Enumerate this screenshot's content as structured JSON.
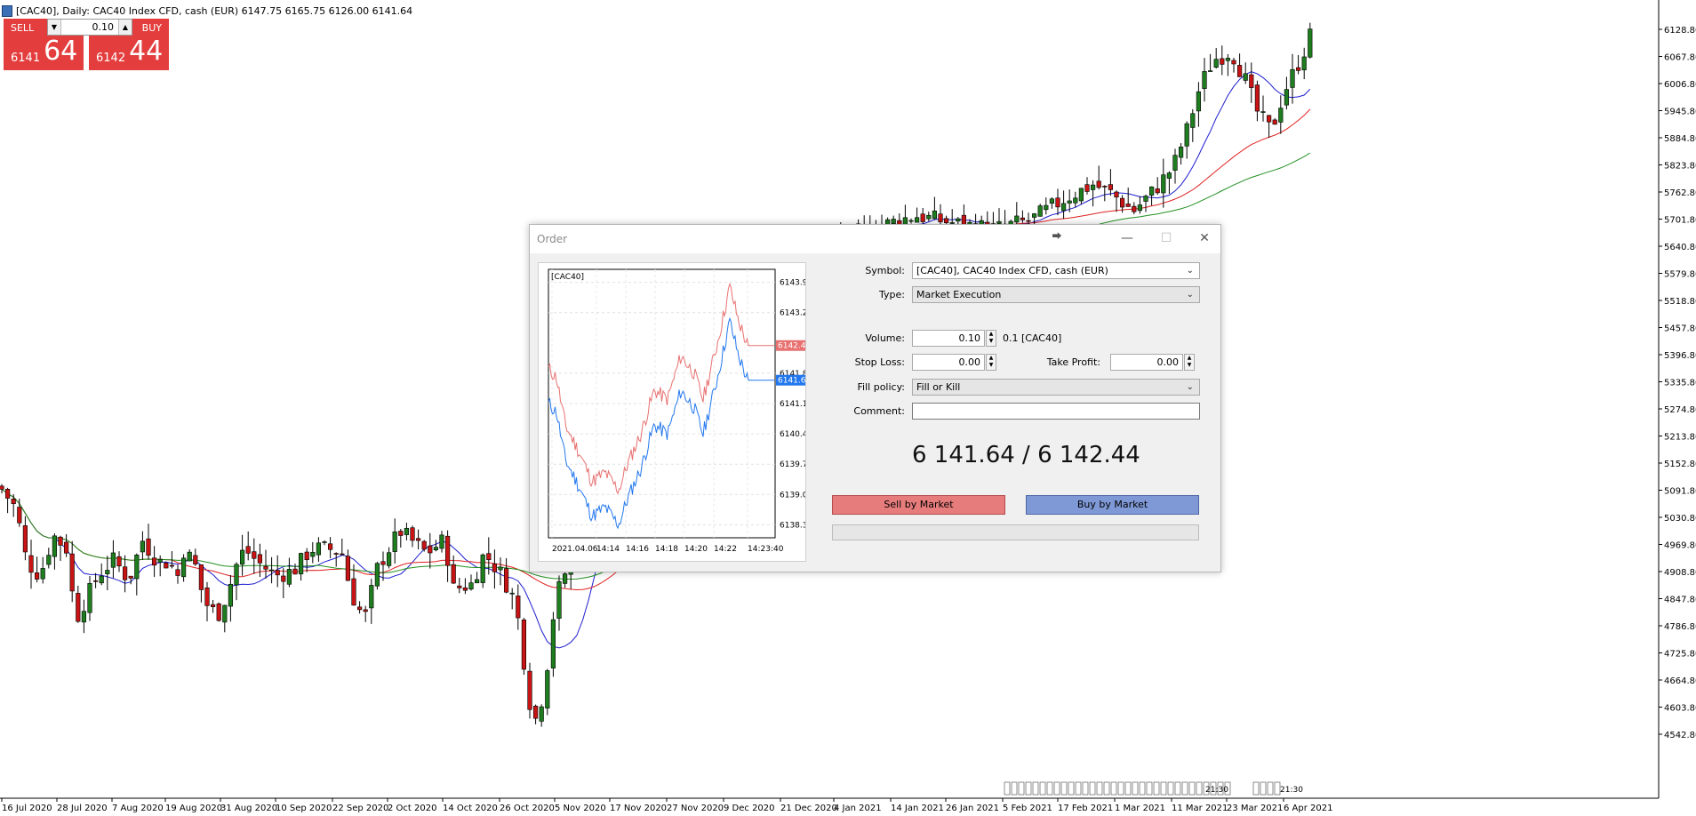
{
  "chart_header": {
    "text": "[CAC40], Daily:  CAC40 Index CFD, cash (EUR)  6147.75 6165.75 6126.00 6141.64"
  },
  "trade_panel": {
    "sell_label": "SELL",
    "buy_label": "BUY",
    "volume": "0.10",
    "sell_price_small": "6141",
    "sell_price_big": "64",
    "buy_price_small": "6142",
    "buy_price_big": "44"
  },
  "chart_data": {
    "type": "candlestick",
    "y_ticks": [
      "6128.80",
      "6067.80",
      "6006.80",
      "5945.80",
      "5884.80",
      "5823.80",
      "5762.80",
      "5701.80",
      "5640.80",
      "5579.80",
      "5518.80",
      "5457.80",
      "5396.80",
      "5335.80",
      "5274.80",
      "5213.80",
      "5152.80",
      "5091.80",
      "5030.80",
      "4969.80",
      "4908.80",
      "4847.80",
      "4786.80",
      "4725.80",
      "4664.80",
      "4603.80",
      "4542.80"
    ],
    "ylim": [
      4520,
      6180
    ],
    "x_labels": [
      "16 Jul 2020",
      "28 Jul 2020",
      "7 Aug 2020",
      "19 Aug 2020",
      "31 Aug 2020",
      "10 Sep 2020",
      "22 Sep 2020",
      "2 Oct 2020",
      "14 Oct 2020",
      "26 Oct 2020",
      "5 Nov 2020",
      "17 Nov 2020",
      "27 Nov 2020",
      "9 Dec 2020",
      "21 Dec 2020",
      "4 Jan 2021",
      "14 Jan 2021",
      "26 Jan 2021",
      "5 Feb 2021",
      "17 Feb 2021",
      "1 Mar 2021",
      "11 Mar 2021",
      "23 Mar 2021",
      "6 Apr 2021"
    ],
    "up_color": "#1e7d1e",
    "down_color": "#c81414",
    "ma_colors": [
      "#1c1cd0",
      "#e02020",
      "#209020"
    ],
    "time_markers": [
      "21:30",
      "21:30"
    ]
  },
  "order_dialog": {
    "title": "Order",
    "mini_chart": {
      "symbol": "[CAC40]",
      "y_ticks": [
        "6143.90",
        "6143.20",
        "6141.80",
        "6141.10",
        "6140.40",
        "6139.70",
        "6139.00",
        "6138.30"
      ],
      "ylim": [
        6138.0,
        6144.2
      ],
      "x_labels": [
        "2021.04.06",
        "14:14",
        "14:16",
        "14:18",
        "14:20",
        "14:22",
        "14:23:40"
      ],
      "ask_label": "6142.44",
      "bid_label": "6141.64",
      "ask_value": 6142.44,
      "bid_value": 6141.64,
      "ask_color": "#e87070",
      "bid_color": "#2277ee"
    },
    "symbol_label": "Symbol:",
    "symbol_value": "[CAC40], CAC40 Index CFD, cash (EUR)",
    "type_label": "Type:",
    "type_value": "Market Execution",
    "volume_label": "Volume:",
    "volume_value": "0.10",
    "volume_note": "0.1 [CAC40]",
    "stop_loss_label": "Stop Loss:",
    "stop_loss_value": "0.00",
    "take_profit_label": "Take Profit:",
    "take_profit_value": "0.00",
    "fill_policy_label": "Fill policy:",
    "fill_policy_value": "Fill or Kill",
    "comment_label": "Comment:",
    "comment_value": "",
    "quote": "6 141.64 / 6 142.44",
    "sell_button": "Sell by Market",
    "buy_button": "Buy by Market"
  }
}
